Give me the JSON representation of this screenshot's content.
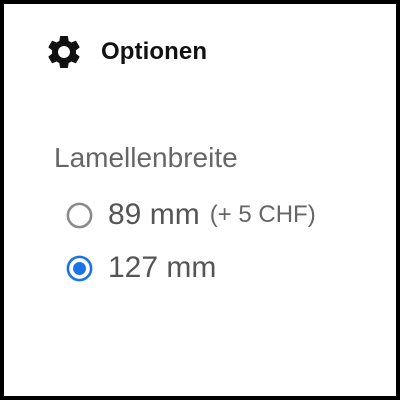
{
  "header": {
    "title": "Optionen",
    "icon": "gear-icon"
  },
  "options_group": {
    "label": "Lamellenbreite",
    "selected_index": 1,
    "accent_color": "#1a73e8",
    "unselected_color": "#8a8a8a",
    "options": [
      {
        "label": "89 mm",
        "extra": "(+ 5 CHF)",
        "selected": false
      },
      {
        "label": "127 mm",
        "extra": "",
        "selected": true
      }
    ]
  }
}
